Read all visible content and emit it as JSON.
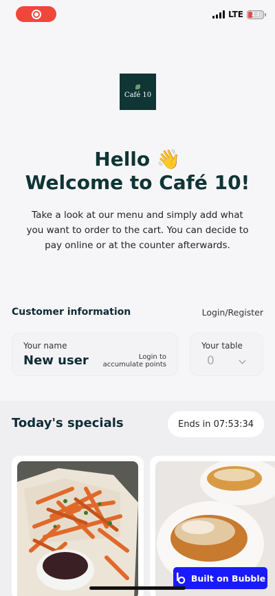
{
  "status_bar": {
    "network": "LTE",
    "battery": "13"
  },
  "logo": {
    "text": "Café 10"
  },
  "hero": {
    "title_line1": "Hello 👋",
    "title_line2": "Welcome to Café 10!",
    "subtitle": "Take a look at our menu and simply add what you want to order to the cart. You can decide to pay online or at the counter afterwards."
  },
  "customer": {
    "title": "Customer information",
    "login_link": "Login/Register",
    "name_label": "Your name",
    "name_value": "New user",
    "login_hint_line1": "Login to",
    "login_hint_line2": "accumulate points",
    "table_label": "Your table",
    "table_value": "0"
  },
  "specials": {
    "title": "Today's specials",
    "ends_in": "Ends in 07:53:34"
  },
  "badge": {
    "label": "Built on Bubble"
  },
  "colors": {
    "brand_dark": "#0f3535",
    "record_red": "#f2463c",
    "bubble_blue": "#1a1aff"
  }
}
